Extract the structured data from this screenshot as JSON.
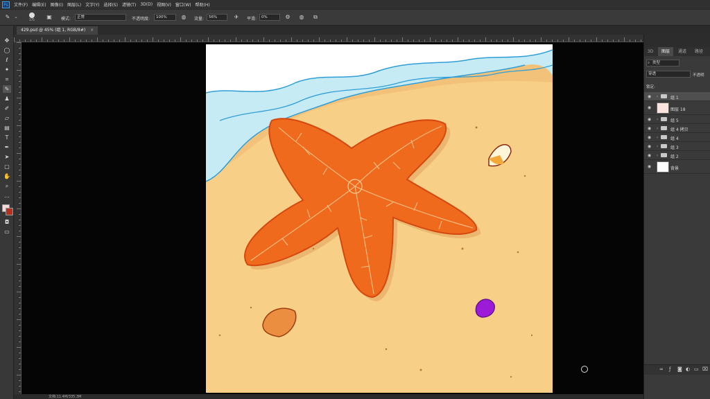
{
  "menubar": {
    "logo": "Ps",
    "items": [
      "文件(F)",
      "编辑(E)",
      "图像(I)",
      "图层(L)",
      "文字(Y)",
      "选择(S)",
      "滤镜(T)",
      "3D(D)",
      "视图(V)",
      "窗口(W)",
      "帮助(H)"
    ]
  },
  "options": {
    "brush_size": "175",
    "mode_label": "模式:",
    "mode_value": "正常",
    "opacity_label": "不透明度:",
    "opacity_value": "100%",
    "flow_label": "流量:",
    "flow_value": "56%",
    "smoothing_label": "平滑:",
    "smoothing_value": "0%"
  },
  "document": {
    "tab_title": "429.psd @ 45% (组 1, RGB/8#)",
    "close": "×"
  },
  "tools": [
    "move-tool",
    "marquee-tool",
    "lasso-tool",
    "quick-select-tool",
    "crop-tool",
    "eyedropper-tool",
    "healing-tool",
    "brush-tool",
    "stamp-tool",
    "history-brush-tool",
    "eraser-tool",
    "gradient-tool",
    "blur-tool",
    "dodge-tool",
    "pen-tool",
    "type-tool",
    "path-select-tool",
    "shape-tool",
    "hand-tool",
    "zoom-tool"
  ],
  "panel": {
    "tabs": [
      "3D",
      "图层",
      "通道",
      "路径"
    ],
    "active_tab": "图层",
    "filter_label": "类型",
    "blend_mode": "穿透",
    "opacity_label": "不透明",
    "lock_label": "锁定:",
    "layers": [
      {
        "name": "组 1",
        "type": "group"
      },
      {
        "name": "图层 18",
        "type": "pixel"
      },
      {
        "name": "组 5",
        "type": "group"
      },
      {
        "name": "组 4 拷贝",
        "type": "group"
      },
      {
        "name": "组 4",
        "type": "group"
      },
      {
        "name": "组 3",
        "type": "group"
      },
      {
        "name": "组 2",
        "type": "group"
      },
      {
        "name": "背景",
        "type": "background"
      }
    ]
  },
  "status": {
    "text": "文档:11.4M/335.3M"
  },
  "colors": {
    "sand": "#f7cf86",
    "starfish": "#ef6a1c",
    "water": "#bfe8f4",
    "shell_purple": "#9b1bd6"
  }
}
